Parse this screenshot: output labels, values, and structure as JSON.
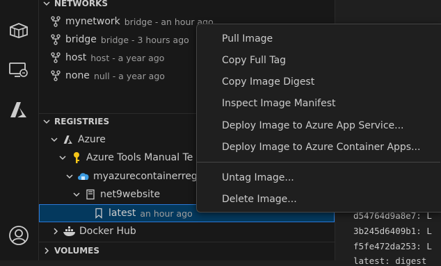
{
  "networks": {
    "header": "NETWORKS",
    "items": [
      {
        "name": "mynetwork",
        "desc": "bridge - an hour ago"
      },
      {
        "name": "bridge",
        "desc": "bridge - 3 hours ago"
      },
      {
        "name": "host",
        "desc": "host - a year ago"
      },
      {
        "name": "none",
        "desc": "null - a year ago"
      }
    ]
  },
  "registries": {
    "header": "REGISTRIES",
    "azure": "Azure",
    "subscription": "Azure Tools Manual Te",
    "registry": "myazurecontainerreg",
    "repository": "net9website",
    "tag": {
      "name": "latest",
      "desc": "an hour ago"
    },
    "docker_hub": "Docker Hub"
  },
  "volumes": {
    "header": "VOLUMES"
  },
  "context_menu": {
    "items": [
      "Pull Image",
      "Copy Full Tag",
      "Copy Image Digest",
      "Inspect Image Manifest",
      "Deploy Image to Azure App Service...",
      "Deploy Image to Azure Container Apps...",
      "Untag Image...",
      "Delete Image..."
    ]
  },
  "editor": {
    "lines": [
      "d54764d9a8e7: L",
      "3b245d6409b1: L",
      "f5fe472da253: L",
      "latest: digest"
    ]
  },
  "colors": {
    "background": "#181818",
    "selection": "#04395e",
    "selection_border": "#2b79d6",
    "azure_blue": "#3c9be0",
    "key_yellow": "#f5c518"
  }
}
